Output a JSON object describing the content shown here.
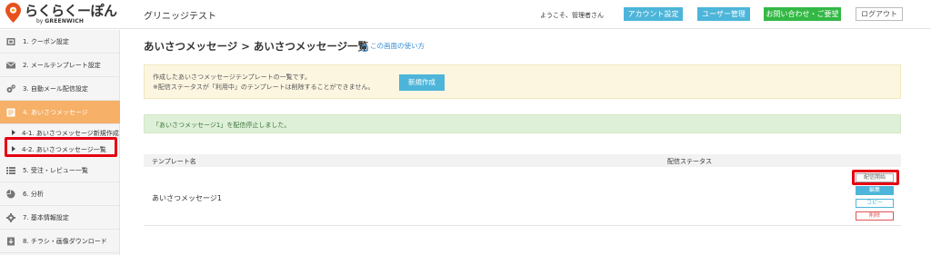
{
  "header": {
    "logo_text": "らくらくーぽん",
    "logo_sub_by": "by",
    "logo_sub_brand": "GREENWICH",
    "app_title": "グリニッジテスト",
    "welcome": "ようこそ、管理者さん",
    "account_button": "アカウント設定",
    "user_button": "ユーザー管理",
    "contact_button": "お問い合わせ・ご要望",
    "logout_button": "ログアウト"
  },
  "sidebar": {
    "items": [
      {
        "label": "1. クーポン設定",
        "icon": "coupon-icon"
      },
      {
        "label": "2. メールテンプレート設定",
        "icon": "mail-icon"
      },
      {
        "label": "3. 自動メール配信設定",
        "icon": "gears-icon"
      },
      {
        "label": "4. あいさつメッセージ",
        "icon": "message-icon"
      },
      {
        "label": "5. 受注・レビュー一覧",
        "icon": "list-icon"
      },
      {
        "label": "6. 分析",
        "icon": "pie-chart-icon"
      },
      {
        "label": "7. 基本情報設定",
        "icon": "gear-icon"
      },
      {
        "label": "8. チラシ・画像ダウンロード",
        "icon": "download-icon"
      }
    ],
    "sub_items": [
      {
        "label": "4-1. あいさつメッセージ新規作成"
      },
      {
        "label": "4-2. あいさつメッセージ一覧"
      }
    ]
  },
  "main": {
    "breadcrumb": "あいさつメッセージ > あいさつメッセージ一覧",
    "help_link": "この画面の使い方",
    "info": {
      "line1": "作成したあいさつメッセージテンプレートの一覧です。",
      "line2": "※配信ステータスが「利用中」のテンプレートは削除することができません。",
      "new_button": "新規作成"
    },
    "success_message": "「あいさつメッセージ1」を配信停止しました。",
    "table": {
      "columns": [
        "テンプレート名",
        "配信ステータス"
      ],
      "rows": [
        {
          "name": "あいさつメッセージ1",
          "start": "配信開始",
          "edit": "編集",
          "copy": "コピー",
          "delete": "削除"
        }
      ]
    }
  },
  "colors": {
    "accent_blue": "#4db5d9",
    "accent_green": "#33b845",
    "active_orange": "#f6b067",
    "highlight_red": "#e60012",
    "info_bg": "#fcf6e1",
    "success_bg": "#dff0d8"
  }
}
